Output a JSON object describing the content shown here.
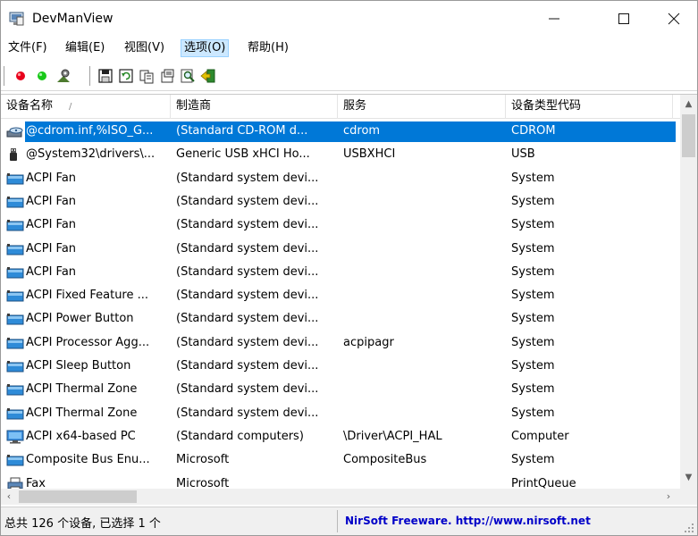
{
  "window": {
    "title": "DevManView",
    "controls": {
      "minimize": "—",
      "close": "✕"
    }
  },
  "menu": [
    {
      "label": "文件(F)"
    },
    {
      "label": "编辑(E)"
    },
    {
      "label": "视图(V)"
    },
    {
      "label": "选项(O)",
      "active": true
    },
    {
      "label": "帮助(H)"
    }
  ],
  "toolbar": {
    "icons": [
      "disable-red-icon",
      "enable-green-icon",
      "properties-icon",
      "save-icon",
      "refresh-icon",
      "copy-icon",
      "html-report-icon",
      "find-icon",
      "exit-icon"
    ]
  },
  "columns": {
    "name": "设备名称",
    "manufacturer": "制造商",
    "service": "服务",
    "type": "设备类型代码",
    "sort_indicator": "/"
  },
  "rows": [
    {
      "icon": "cdrom",
      "name": "@cdrom.inf,%ISO_G...",
      "manufacturer": "(Standard CD-ROM d...",
      "service": "cdrom",
      "type": "CDROM",
      "selected": true
    },
    {
      "icon": "usb",
      "name": "@System32\\drivers\\...",
      "manufacturer": "Generic USB xHCI Ho...",
      "service": "USBXHCI",
      "type": "USB"
    },
    {
      "icon": "system",
      "name": "ACPI Fan",
      "manufacturer": "(Standard system devi...",
      "service": "",
      "type": "System"
    },
    {
      "icon": "system",
      "name": "ACPI Fan",
      "manufacturer": "(Standard system devi...",
      "service": "",
      "type": "System"
    },
    {
      "icon": "system",
      "name": "ACPI Fan",
      "manufacturer": "(Standard system devi...",
      "service": "",
      "type": "System"
    },
    {
      "icon": "system",
      "name": "ACPI Fan",
      "manufacturer": "(Standard system devi...",
      "service": "",
      "type": "System"
    },
    {
      "icon": "system",
      "name": "ACPI Fan",
      "manufacturer": "(Standard system devi...",
      "service": "",
      "type": "System"
    },
    {
      "icon": "system",
      "name": "ACPI Fixed Feature ...",
      "manufacturer": "(Standard system devi...",
      "service": "",
      "type": "System"
    },
    {
      "icon": "system",
      "name": "ACPI Power Button",
      "manufacturer": "(Standard system devi...",
      "service": "",
      "type": "System"
    },
    {
      "icon": "system",
      "name": "ACPI Processor Agg...",
      "manufacturer": "(Standard system devi...",
      "service": "acpipagr",
      "type": "System"
    },
    {
      "icon": "system",
      "name": "ACPI Sleep Button",
      "manufacturer": "(Standard system devi...",
      "service": "",
      "type": "System"
    },
    {
      "icon": "system",
      "name": "ACPI Thermal Zone",
      "manufacturer": "(Standard system devi...",
      "service": "",
      "type": "System"
    },
    {
      "icon": "system",
      "name": "ACPI Thermal Zone",
      "manufacturer": "(Standard system devi...",
      "service": "",
      "type": "System"
    },
    {
      "icon": "computer",
      "name": "ACPI x64-based PC",
      "manufacturer": "(Standard computers)",
      "service": "\\Driver\\ACPI_HAL",
      "type": "Computer"
    },
    {
      "icon": "system",
      "name": "Composite Bus Enu...",
      "manufacturer": "Microsoft",
      "service": "CompositeBus",
      "type": "System"
    },
    {
      "icon": "printer",
      "name": "Fax",
      "manufacturer": "Microsoft",
      "service": "",
      "type": "PrintQueue"
    }
  ],
  "status": {
    "summary": "总共 126 个设备, 已选择 1 个",
    "link": "NirSoft Freeware.  http://www.nirsoft.net"
  },
  "colors": {
    "selection": "#0078d7",
    "menu_active": "#cce8ff",
    "link": "#0000c8"
  }
}
